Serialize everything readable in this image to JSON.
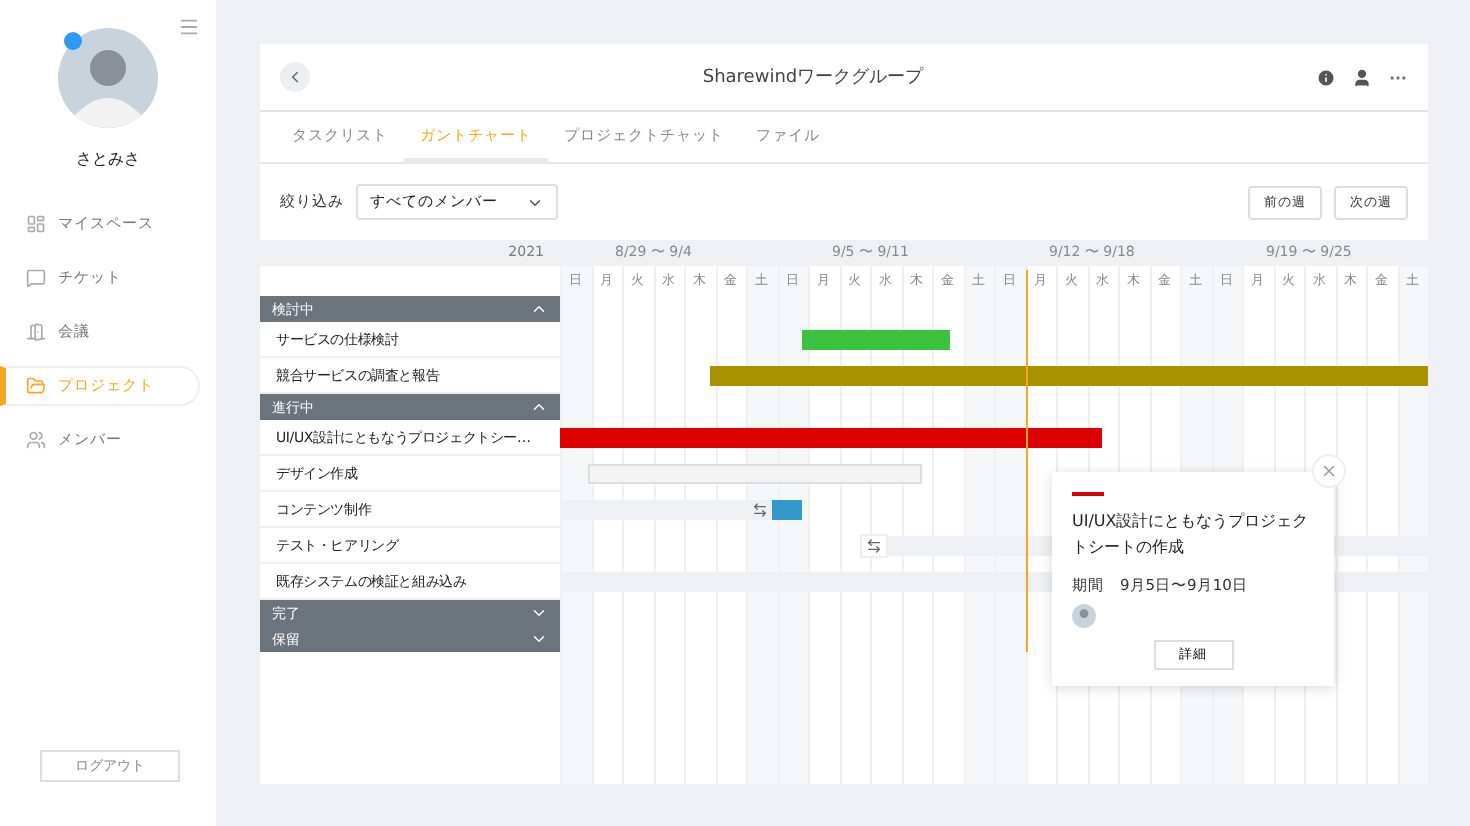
{
  "sidebar": {
    "user": {
      "name": "さとみさ",
      "online": true
    },
    "items": [
      {
        "label": "マイスペース",
        "selected": false
      },
      {
        "label": "チケット",
        "selected": false
      },
      {
        "label": "会議",
        "selected": false
      },
      {
        "label": "プロジェクト",
        "selected": true
      },
      {
        "label": "メンバー",
        "selected": false
      }
    ],
    "logout": "ログアウト"
  },
  "header": {
    "title": "Sharewindワークグループ"
  },
  "tabs": [
    {
      "label": "タスクリスト",
      "selected": false
    },
    {
      "label": "ガントチャート",
      "selected": true
    },
    {
      "label": "プロジェクトチャット",
      "selected": false
    },
    {
      "label": "ファイル",
      "selected": false
    }
  ],
  "filter": {
    "label": "絞り込み",
    "value": "すべてのメンバー"
  },
  "buttons": [
    "前の週",
    "次の週"
  ],
  "timeline": {
    "year": "2021",
    "weeks": [
      "8/29 〜 9/4",
      "9/5 〜 9/11",
      "9/12 〜 9/18",
      "9/19 〜 9/25"
    ],
    "days": [
      "日",
      "月",
      "火",
      "水",
      "木",
      "金",
      "土",
      "日",
      "月",
      "火",
      "水",
      "木",
      "金",
      "土",
      "日",
      "月",
      "火",
      "水",
      "木",
      "金",
      "土",
      "日",
      "月",
      "火",
      "水",
      "木",
      "金",
      "土"
    ]
  },
  "groups": [
    {
      "name": "検討中",
      "expanded": true,
      "tasks": [
        {
          "name": "サービスの仕様検討",
          "kind": "bar",
          "color": "#3dbf3f"
        },
        {
          "name": "競合サービスの調査と報告",
          "kind": "bar",
          "color": "#a89200"
        }
      ]
    },
    {
      "name": "進行中",
      "expanded": true,
      "tasks": [
        {
          "name": "UI/UX設計にともなうプロジェクトシー…",
          "kind": "bar",
          "color": "#dd0000"
        },
        {
          "name": "デザイン作成",
          "kind": "draft"
        },
        {
          "name": "コンテンツ制作",
          "kind": "track",
          "color": "#3399cc"
        },
        {
          "name": "テスト・ヒアリング",
          "kind": "marker"
        },
        {
          "name": "既存システムの検証と組み込み",
          "kind": "track"
        }
      ]
    },
    {
      "name": "完了",
      "expanded": false
    },
    {
      "name": "保留",
      "expanded": false
    }
  ],
  "popup": {
    "title": "UI/UX設計にともなうプロジェクトシートの作成",
    "color": "#dd0000",
    "period_label": "期間",
    "period": "9月5日〜9月10日",
    "button": "詳細"
  }
}
